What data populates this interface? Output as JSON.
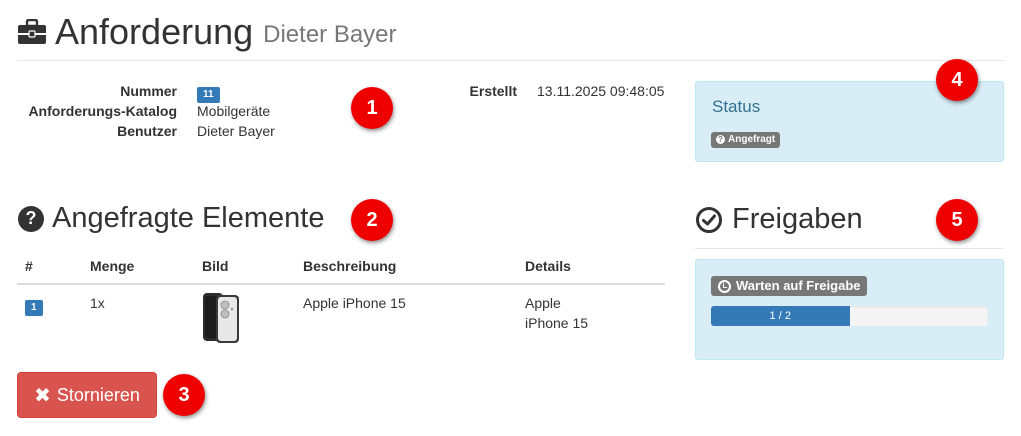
{
  "header": {
    "title": "Anforderung",
    "subtitle": "Dieter Bayer",
    "icon": "briefcase-icon"
  },
  "details": {
    "nummer_label": "Nummer",
    "nummer_value": "11",
    "katalog_label": "Anforderungs-Katalog",
    "katalog_value": "Mobilgeräte",
    "benutzer_label": "Benutzer",
    "benutzer_value": "Dieter Bayer",
    "erstellt_label": "Erstellt",
    "erstellt_value": "13.11.2025 09:48:05"
  },
  "status": {
    "title": "Status",
    "badge": "Angefragt",
    "badge_icon": "question-circle-icon"
  },
  "elements": {
    "heading": "Angefragte Elemente",
    "icon": "question-circle-icon",
    "columns": [
      "#",
      "Menge",
      "Bild",
      "Beschreibung",
      "Details"
    ],
    "rows": [
      {
        "index": "1",
        "menge": "1x",
        "bild": "iphone-image",
        "beschreibung": "Apple iPhone 15",
        "details_line1": "Apple",
        "details_line2": "iPhone 15"
      }
    ]
  },
  "actions": {
    "cancel_label": "Stornieren",
    "cancel_icon": "times-icon"
  },
  "freigaben": {
    "heading": "Freigaben",
    "icon": "check-circle-icon",
    "badge": "Warten auf Freigabe",
    "badge_icon": "clock-icon",
    "progress_text": "1 / 2",
    "progress_fraction": 0.5
  },
  "callouts": [
    "1",
    "2",
    "3",
    "4",
    "5"
  ],
  "colors": {
    "primary": "#337ab7",
    "danger": "#d9534f",
    "info_bg": "#d9edf7",
    "callout": "#ee0000",
    "badge_grey": "#777777"
  }
}
